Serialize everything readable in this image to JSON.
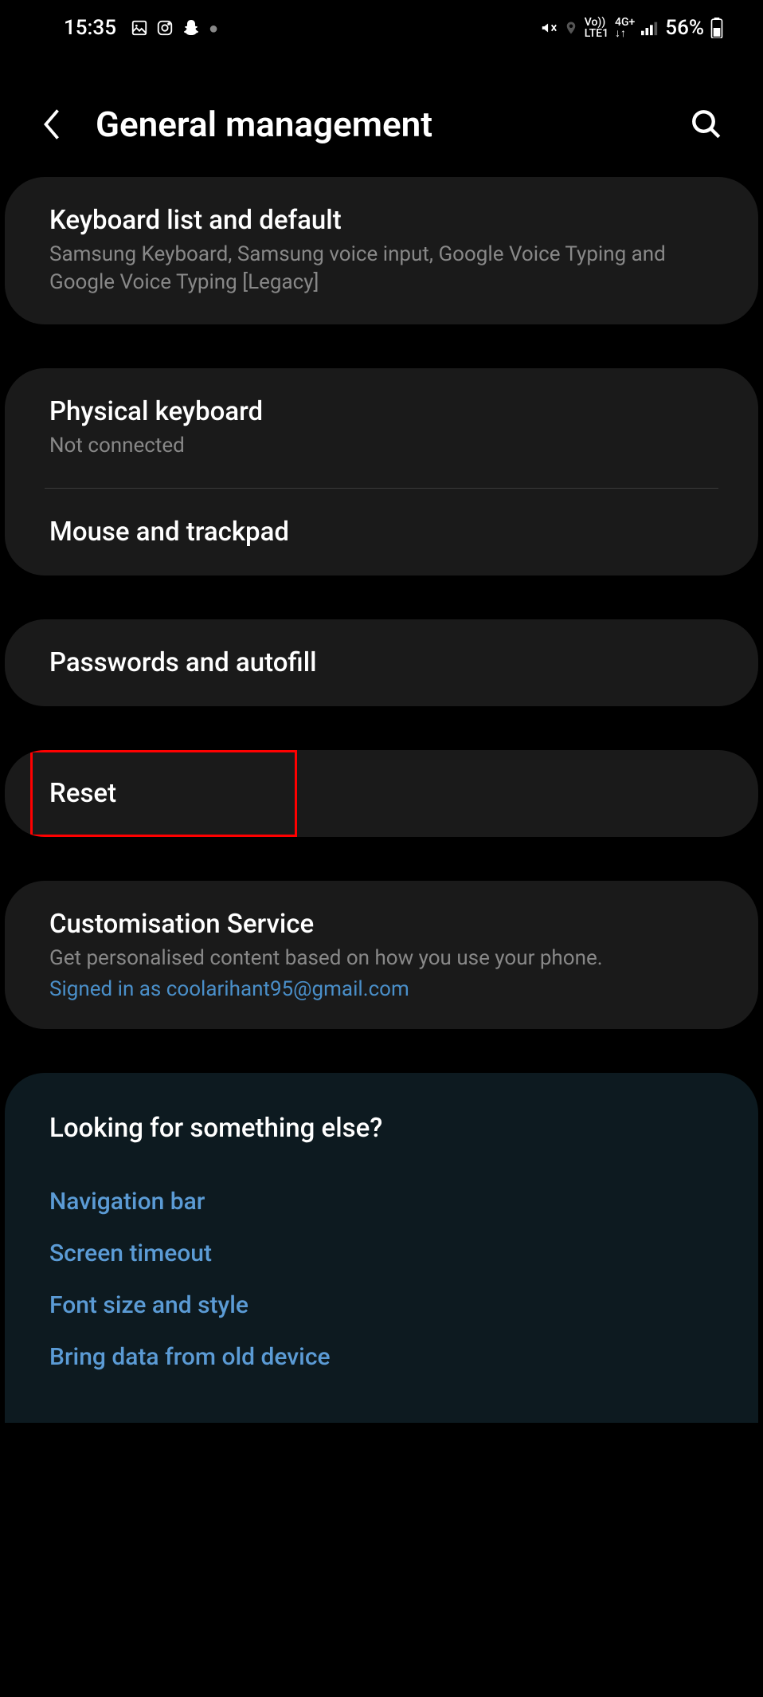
{
  "statusBar": {
    "time": "15:35",
    "battery": "56%",
    "netLine1": "Vo))",
    "netLine2": "LTE1",
    "netLine3": "4G+"
  },
  "header": {
    "title": "General management"
  },
  "cards": {
    "keyboard": {
      "title": "Keyboard list and default",
      "subtitle": "Samsung Keyboard, Samsung voice input, Google Voice Typing and Google Voice Typing [Legacy]"
    },
    "physicalKeyboard": {
      "title": "Physical keyboard",
      "subtitle": "Not connected"
    },
    "mouse": {
      "title": "Mouse and trackpad"
    },
    "passwords": {
      "title": "Passwords and autofill"
    },
    "reset": {
      "title": "Reset"
    },
    "customisation": {
      "title": "Customisation Service",
      "subtitle": "Get personalised content based on how you use your phone.",
      "link": "Signed in as coolarihant95@gmail.com"
    }
  },
  "footer": {
    "title": "Looking for something else?",
    "links": [
      "Navigation bar",
      "Screen timeout",
      "Font size and style",
      "Bring data from old device"
    ]
  }
}
